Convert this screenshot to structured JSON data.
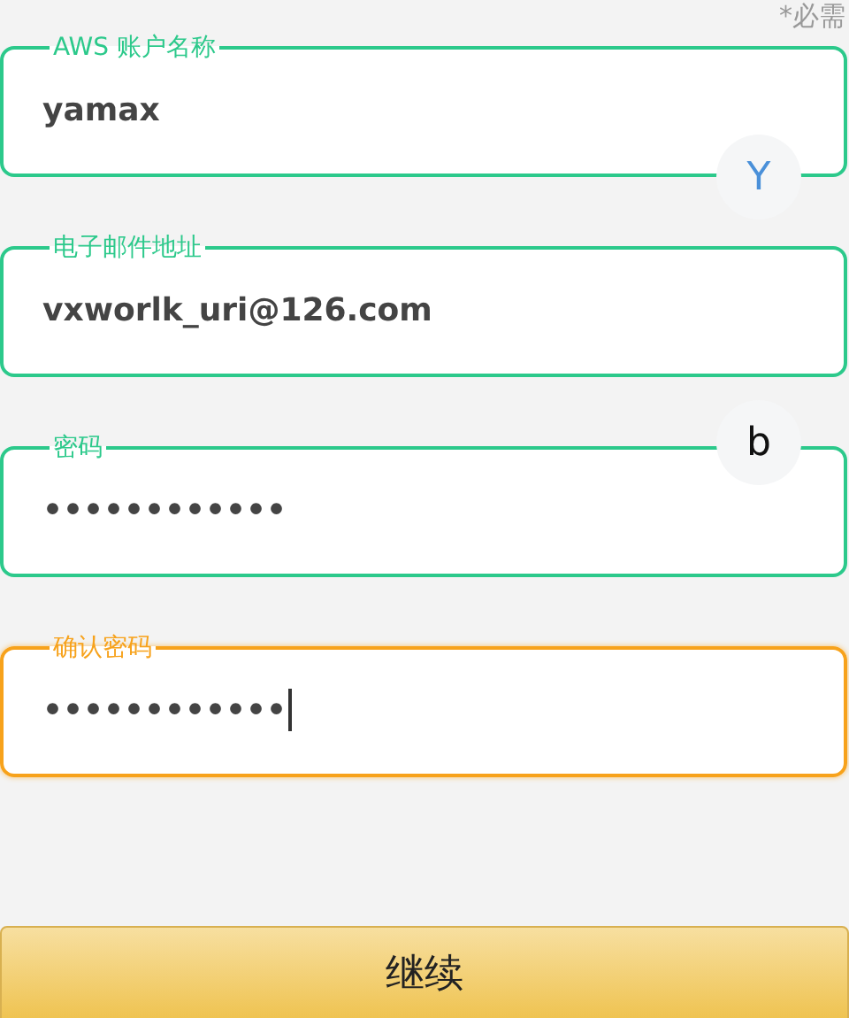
{
  "required_note": "*必需",
  "fields": [
    {
      "label": "AWS 账户名称",
      "value": "yamax",
      "focused": false,
      "bubble": {
        "text": "Y",
        "kind": "bottom"
      }
    },
    {
      "label": "电子邮件地址",
      "value": "vxworlk_uri@126.com",
      "focused": false
    },
    {
      "label": "密码",
      "value": "••••••••••••",
      "focused": false,
      "bubble": {
        "text": "b",
        "kind": "top"
      }
    },
    {
      "label": "确认密码",
      "value": "••••••••••••",
      "focused": true
    }
  ],
  "continue_button": "继续"
}
